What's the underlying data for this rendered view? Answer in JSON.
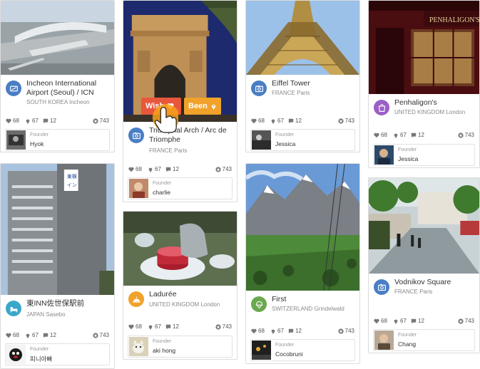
{
  "stat_labels": {
    "heart": "68",
    "pin": "67",
    "comment": "12",
    "star": "743"
  },
  "founder_label": "Founder",
  "actions": {
    "wish": "Wish",
    "been": "Been"
  },
  "colors": {
    "monument_blue": "#4a7ec4",
    "food_orange": "#f0a22a",
    "shop_purple": "#9b5fc6",
    "nature_green": "#6aa84f",
    "hotel_teal": "#3aa7c9",
    "wish_red": "#e8573c"
  },
  "cards": [
    {
      "name": "Incheon International Airport (Seoul) / ICN",
      "location": "SOUTH KOREA Incheon",
      "category_icon": "airport-icon",
      "founder": "Hyok"
    },
    {
      "name": "Triumphal Arch / Arc de Triomphe",
      "location": "FRANCE Paris",
      "category_icon": "monument-icon",
      "founder": "charlie"
    },
    {
      "name": "Eiffel Tower",
      "location": "FRANCE Paris",
      "category_icon": "monument-icon",
      "founder": "Jessica"
    },
    {
      "name": "Penhaligon's",
      "location": "UNITED KINGDOM London",
      "category_icon": "shopping-icon",
      "founder": "Jessica"
    },
    {
      "name": "東INN佐世保駅前",
      "location": "JAPAN Sasebo",
      "category_icon": "hotel-icon",
      "founder": "피니아빠"
    },
    {
      "name": "Ladurée",
      "location": "UNITED KINGDOM London",
      "category_icon": "food-icon",
      "founder": "aki hong"
    },
    {
      "name": "First",
      "location": "SWITZERLAND Grindelwald",
      "category_icon": "nature-icon",
      "founder": "Cocobruni"
    },
    {
      "name": "Vodnikov Square",
      "location": "FRANCE Paris",
      "category_icon": "monument-icon",
      "founder": "Chang"
    }
  ]
}
